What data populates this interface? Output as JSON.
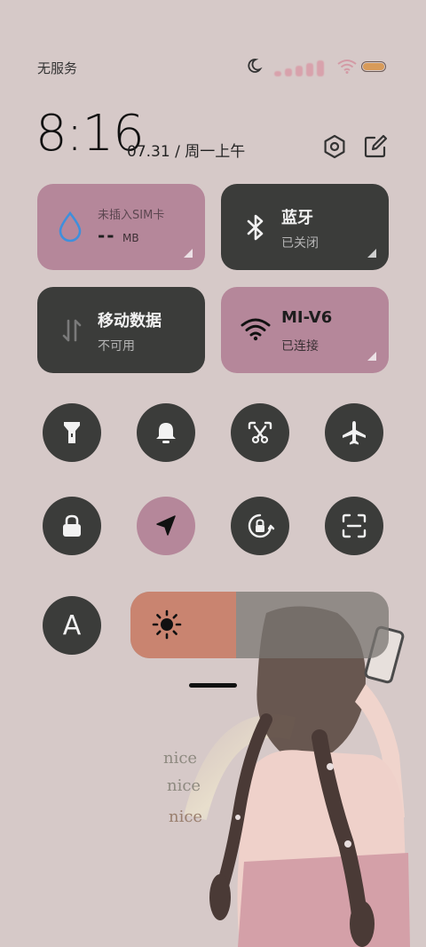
{
  "status_bar": {
    "carrier": "无服务",
    "icons": [
      "moon-icon",
      "signal-icon",
      "wifi-icon",
      "battery-icon"
    ],
    "battery_level": 1.0
  },
  "header": {
    "time": "8:16",
    "date": "07.31 / 周一上午",
    "icons": [
      "settings-hex-icon",
      "edit-icon"
    ]
  },
  "tiles": {
    "data_usage": {
      "line1": "未插入SIM卡",
      "value": "--",
      "unit": "MB",
      "icon": "water-drop-icon"
    },
    "bluetooth": {
      "title": "蓝牙",
      "status": "已关闭",
      "icon": "bluetooth-icon"
    },
    "mobile_data": {
      "title": "移动数据",
      "status": "不可用",
      "icon": "data-arrows-icon"
    },
    "wifi": {
      "title": "MI-V6",
      "status": "已连接",
      "icon": "wifi-icon"
    }
  },
  "toggles_row1": [
    "flashlight-icon",
    "bell-icon",
    "screenshot-scissors-icon",
    "airplane-icon"
  ],
  "toggles_row2": [
    "lock-icon",
    "location-arrow-icon",
    "rotation-lock-icon",
    "scan-icon"
  ],
  "brightness": {
    "auto_label": "A",
    "level": 0.41,
    "icon": "sun-icon"
  },
  "wallpaper": {
    "text": [
      "nice",
      "nice",
      "nice"
    ]
  },
  "colors": {
    "pink_tile": "#b5879a",
    "dark_tile": "#3b3c3a",
    "brightness_fill": "#c98470",
    "background": "#d6c9c8"
  }
}
